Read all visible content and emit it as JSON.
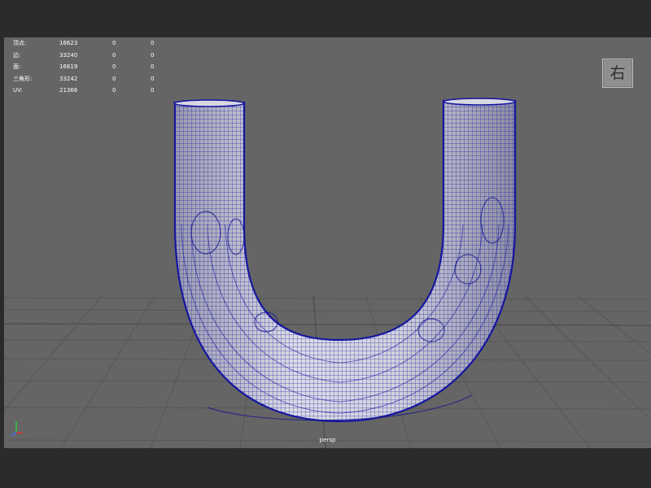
{
  "hud": {
    "rows": [
      {
        "label": "顶点:",
        "v1": "16623",
        "v2": "0",
        "v3": "0"
      },
      {
        "label": "边:",
        "v1": "33240",
        "v2": "0",
        "v3": "0"
      },
      {
        "label": "面:",
        "v1": "16619",
        "v2": "0",
        "v3": "0"
      },
      {
        "label": "三角形:",
        "v1": "33242",
        "v2": "0",
        "v3": "0"
      },
      {
        "label": "UV:",
        "v1": "21366",
        "v2": "0",
        "v3": "0"
      }
    ]
  },
  "viewcube": {
    "label": "右"
  },
  "camera": {
    "label": "persp"
  },
  "colors": {
    "viewport_bg": "#656565",
    "wireframe": "#1a1aa0",
    "shading": "#c9c9d6",
    "grid": "#555555"
  },
  "icons": {
    "axis": "axis-gizmo-icon"
  }
}
